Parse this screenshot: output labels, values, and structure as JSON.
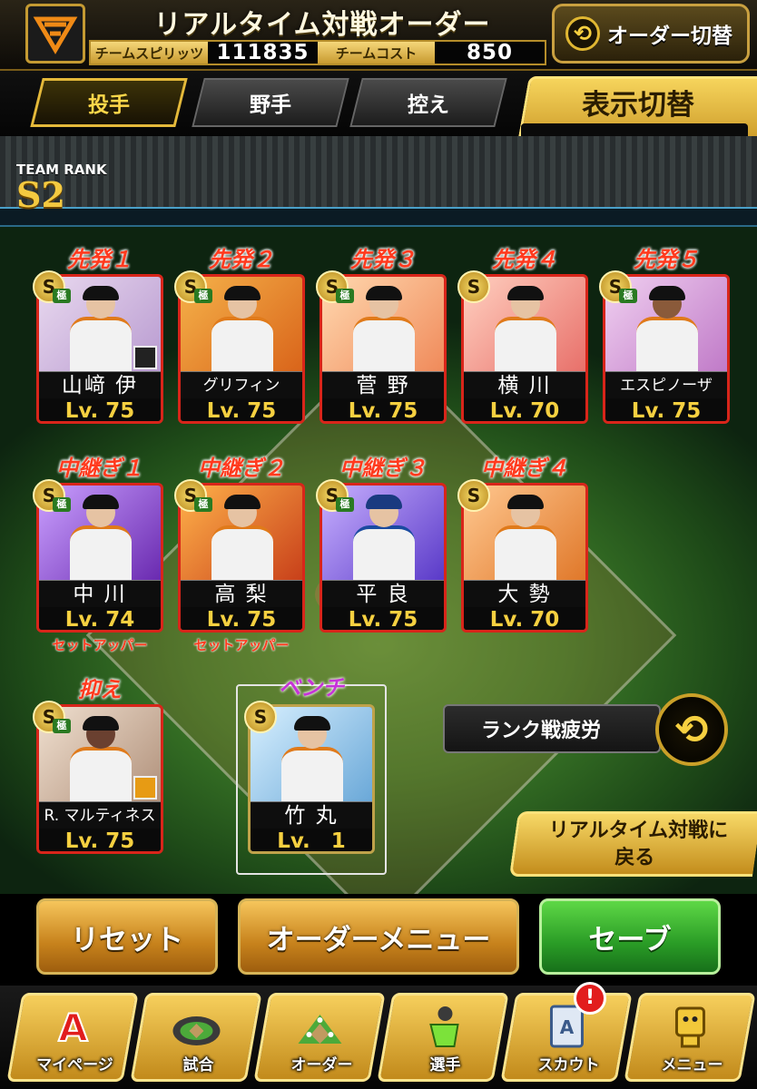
{
  "header": {
    "title": "リアルタイム対戦オーダー",
    "logo_icon": "giants-logo-icon",
    "spirits_label": "チームスピリッツ",
    "spirits_value": "111835",
    "cost_label": "チームコスト",
    "cost_value": "850",
    "order_switch_label": "オーダー切替"
  },
  "tabs": [
    {
      "label": "投手",
      "active": true
    },
    {
      "label": "野手",
      "active": false
    },
    {
      "label": "控え",
      "active": false
    }
  ],
  "display_switch": {
    "label": "表示切替",
    "value": "ー"
  },
  "team_rank": {
    "label": "TEAM RANK",
    "value": "S2"
  },
  "starters": [
    {
      "slot": "先発１",
      "name": "山﨑 伊",
      "level": "Lv. 75",
      "rank": "S",
      "kyoku": true,
      "marker": "dark"
    },
    {
      "slot": "先発２",
      "name": "グリフィン",
      "level": "Lv. 75",
      "rank": "S",
      "kyoku": true,
      "marker": ""
    },
    {
      "slot": "先発３",
      "name": "菅 野",
      "level": "Lv. 75",
      "rank": "S",
      "kyoku": true,
      "marker": ""
    },
    {
      "slot": "先発４",
      "name": "横 川",
      "level": "Lv. 70",
      "rank": "S",
      "kyoku": false,
      "marker": ""
    },
    {
      "slot": "先発５",
      "name": "エスピノーザ",
      "level": "Lv. 75",
      "rank": "S",
      "kyoku": true,
      "marker": ""
    }
  ],
  "relievers": [
    {
      "slot": "中継ぎ１",
      "name": "中 川",
      "level": "Lv. 74",
      "rank": "S",
      "kyoku": true,
      "role": "セットアッパー"
    },
    {
      "slot": "中継ぎ２",
      "name": "高 梨",
      "level": "Lv. 75",
      "rank": "S",
      "kyoku": true,
      "role": "セットアッパー"
    },
    {
      "slot": "中継ぎ３",
      "name": "平 良",
      "level": "Lv. 75",
      "rank": "S",
      "kyoku": true,
      "role": ""
    },
    {
      "slot": "中継ぎ４",
      "name": "大 勢",
      "level": "Lv. 70",
      "rank": "S",
      "kyoku": false,
      "role": ""
    }
  ],
  "closer": {
    "slot": "抑え",
    "name": "R. マルティネス",
    "level": "Lv. 75",
    "rank": "S",
    "kyoku": true
  },
  "bench": {
    "slot": "ベンチ",
    "name": "竹 丸",
    "level": "Lv.　1",
    "rank": "S"
  },
  "fatigue": {
    "label": "ランク戦疲労"
  },
  "back_button": {
    "line1": "リアルタイム対戦に",
    "line2": "戻る"
  },
  "actions": {
    "reset": "リセット",
    "order_menu": "オーダーメニュー",
    "save": "セーブ"
  },
  "nav": [
    {
      "label": "マイページ",
      "icon": "a-logo-icon"
    },
    {
      "label": "試合",
      "icon": "stadium-icon"
    },
    {
      "label": "オーダー",
      "icon": "field-icon"
    },
    {
      "label": "選手",
      "icon": "player-icon"
    },
    {
      "label": "スカウト",
      "icon": "scout-card-icon"
    },
    {
      "label": "メニュー",
      "icon": "menu-character-icon"
    }
  ],
  "nav_alert": "!"
}
